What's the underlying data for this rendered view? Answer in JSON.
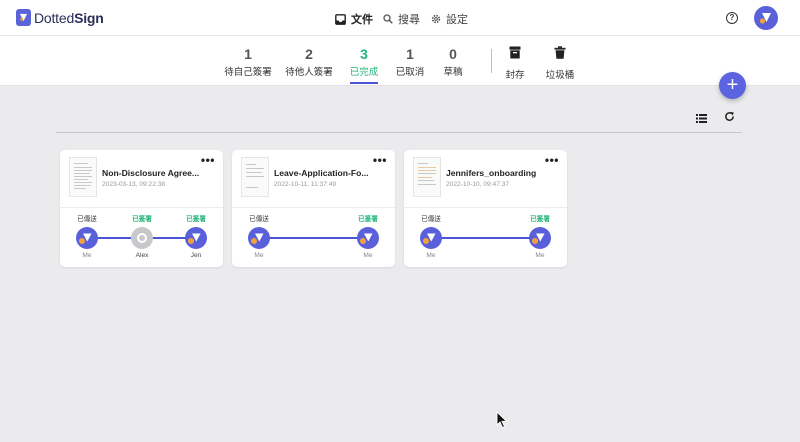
{
  "app": {
    "logo": {
      "text_light": "Dotted",
      "text_bold": "Sign"
    }
  },
  "topnav": [
    {
      "label": "文件",
      "icon": "inbox-icon"
    },
    {
      "label": "搜尋",
      "icon": "search-icon"
    },
    {
      "label": "設定",
      "icon": "gear-icon"
    }
  ],
  "header": {
    "help": "?",
    "help_icon": "help-circle-icon",
    "avatar_icon": "user-avatar-icon"
  },
  "status_tabs": [
    {
      "count": "1",
      "label": "待自己簽署"
    },
    {
      "count": "2",
      "label": "待他人簽署"
    },
    {
      "count": "3",
      "label": "已完成",
      "active": true
    },
    {
      "count": "1",
      "label": "已取消"
    },
    {
      "count": "0",
      "label": "草稿"
    }
  ],
  "actions": [
    {
      "label": "封存",
      "icon": "archive-icon"
    },
    {
      "label": "垃圾桶",
      "icon": "trash-icon"
    }
  ],
  "fab": {
    "label": "+",
    "icon": "plus-icon"
  },
  "toolbar": {
    "list_icon": "list-view-icon",
    "refresh_icon": "refresh-icon"
  },
  "colors": {
    "accent": "#4b54d4",
    "success": "#24b37a",
    "avatar": "#5a60da",
    "dot": "#f2a23d"
  },
  "documents": [
    {
      "title": "Non-Disclosure Agree...",
      "date": "2023-03-13, 09:22:38",
      "more": "•••",
      "signers": [
        {
          "status": "已傳送",
          "name": "Me"
        },
        {
          "status": "已簽署",
          "name": "Alex"
        },
        {
          "status": "已簽署",
          "name": "Jen"
        }
      ]
    },
    {
      "title": "Leave-Application-Fo...",
      "date": "2022-10-11, 11:37:49",
      "more": "•••",
      "signers": [
        {
          "status": "已傳送",
          "name": "Me"
        },
        {
          "status": "已簽署",
          "name": "Me"
        }
      ]
    },
    {
      "title": "Jennifers_onboarding",
      "date": "2022-10-10, 09:47:37",
      "more": "•••",
      "signers": [
        {
          "status": "已傳送",
          "name": "Me"
        },
        {
          "status": "已簽署",
          "name": "Me"
        }
      ]
    }
  ]
}
